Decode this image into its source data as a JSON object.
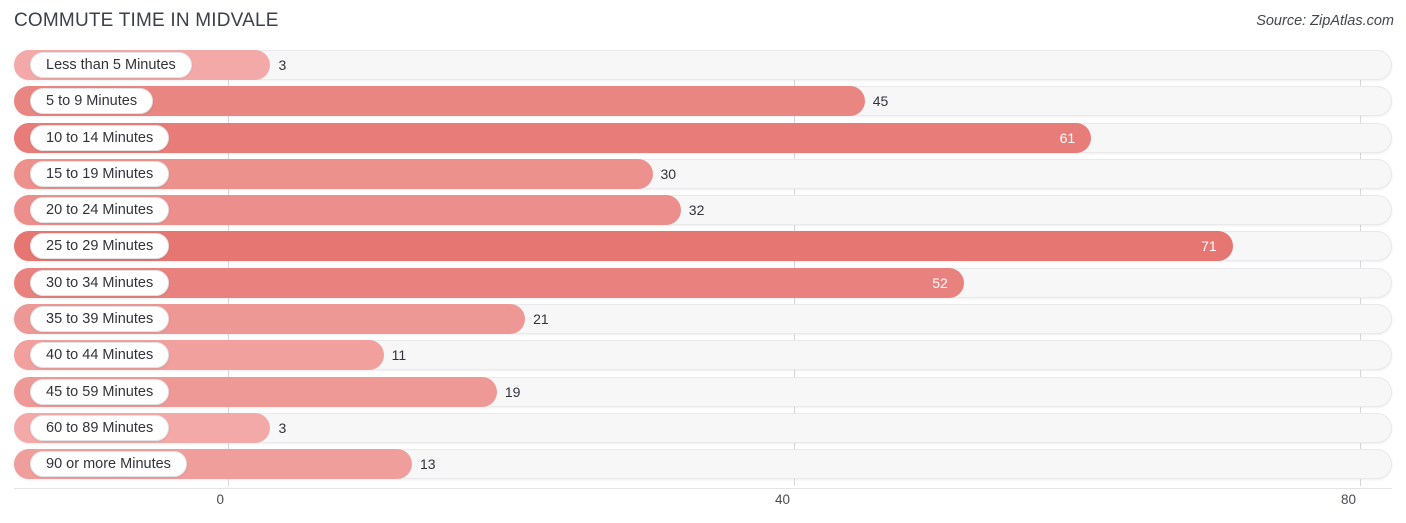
{
  "header": {
    "title": "COMMUTE TIME IN MIDVALE",
    "source": "Source: ZipAtlas.com"
  },
  "axis": {
    "ticks": [
      "0",
      "40",
      "80"
    ],
    "tick_values": [
      0,
      40,
      80
    ],
    "min": 0,
    "max": 80
  },
  "colors": {
    "bar_low": "#f4aeac",
    "bar_high": "#e5716c",
    "track": "#f7f7f8",
    "gridline": "#d8d8dc",
    "label_text": "#32323a",
    "value_text_outside": "#32323a",
    "value_text_inside": "#ffffff"
  },
  "chart_data": {
    "type": "bar",
    "orientation": "horizontal",
    "title": "COMMUTE TIME IN MIDVALE",
    "subtitle": "",
    "xlabel": "",
    "ylabel": "",
    "xlim": [
      0,
      80
    ],
    "grid": true,
    "legend": "none",
    "categories": [
      "Less than 5 Minutes",
      "5 to 9 Minutes",
      "10 to 14 Minutes",
      "15 to 19 Minutes",
      "20 to 24 Minutes",
      "25 to 29 Minutes",
      "30 to 34 Minutes",
      "35 to 39 Minutes",
      "40 to 44 Minutes",
      "45 to 59 Minutes",
      "60 to 89 Minutes",
      "90 or more Minutes"
    ],
    "values": [
      3,
      45,
      61,
      30,
      32,
      71,
      52,
      21,
      11,
      19,
      3,
      13
    ],
    "value_labels": [
      "3",
      "45",
      "61",
      "30",
      "32",
      "71",
      "52",
      "21",
      "11",
      "19",
      "3",
      "13"
    ],
    "label_position": [
      "outside",
      "outside",
      "inside",
      "outside",
      "outside",
      "inside",
      "inside",
      "outside",
      "outside",
      "outside",
      "outside",
      "outside"
    ],
    "ticks": [
      "0",
      "40",
      "80"
    ]
  }
}
